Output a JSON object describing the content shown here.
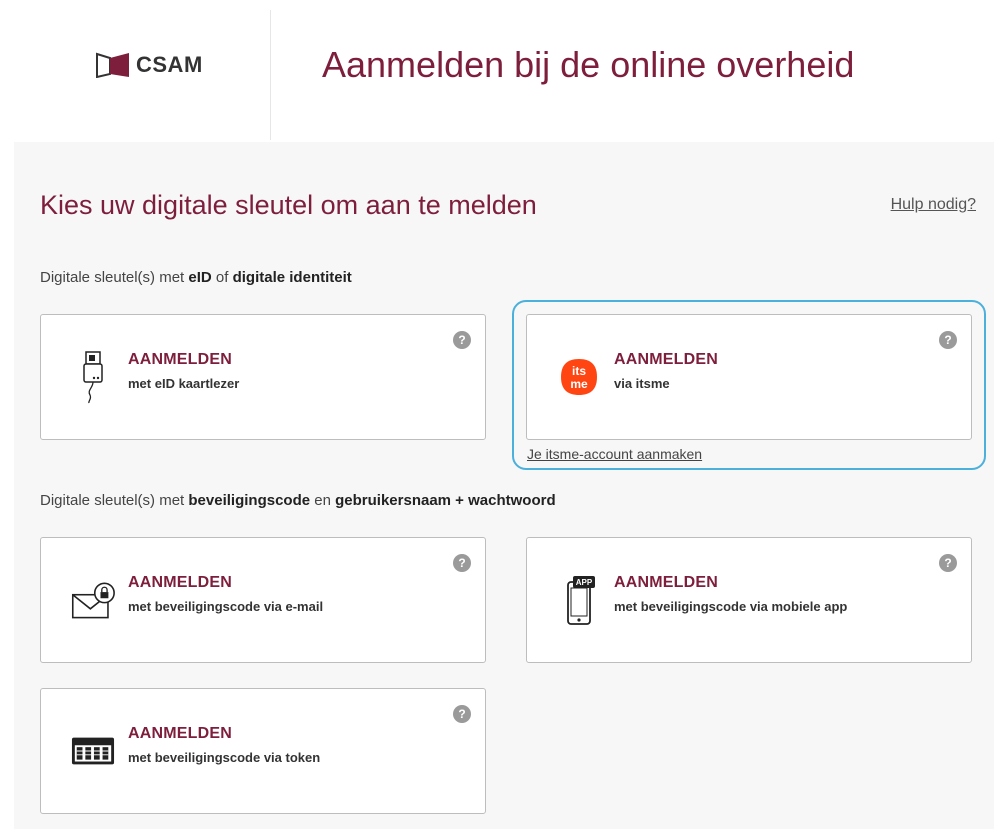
{
  "header": {
    "logo_text": "CSAM",
    "title": "Aanmelden bij de online overheid"
  },
  "main": {
    "heading": "Kies uw digitale sleutel om aan te melden",
    "help_link": "Hulp nodig?",
    "group1": {
      "prefix": "Digitale sleutel(s) met ",
      "bold1": "eID",
      "mid": " of ",
      "bold2": "digitale identiteit"
    },
    "group2": {
      "prefix": "Digitale sleutel(s) met ",
      "bold1": "beveiligingscode",
      "mid": " en ",
      "bold2": "gebruikersnaam + wachtwoord"
    },
    "cards": [
      {
        "title": "AANMELDEN",
        "sub": "met eID kaartlezer",
        "icon": "card-reader-icon"
      },
      {
        "title": "AANMELDEN",
        "sub": "via itsme",
        "icon": "itsme-icon",
        "icon_text_1": "its",
        "icon_text_2": "me"
      },
      {
        "title": "AANMELDEN",
        "sub": "met beveiligingscode via e-mail",
        "icon": "email-lock-icon"
      },
      {
        "title": "AANMELDEN",
        "sub": "met beveiligingscode via mobiele app",
        "icon": "mobile-app-icon",
        "icon_text": "APP"
      },
      {
        "title": "AANMELDEN",
        "sub": "met beveiligingscode via token",
        "icon": "token-icon"
      }
    ],
    "help_icon_glyph": "?",
    "itsme_account_link": "Je itsme-account aanmaken"
  },
  "colors": {
    "brand": "#7d1e3c",
    "highlight": "#4bb0dc",
    "itsme": "#ff4612"
  }
}
